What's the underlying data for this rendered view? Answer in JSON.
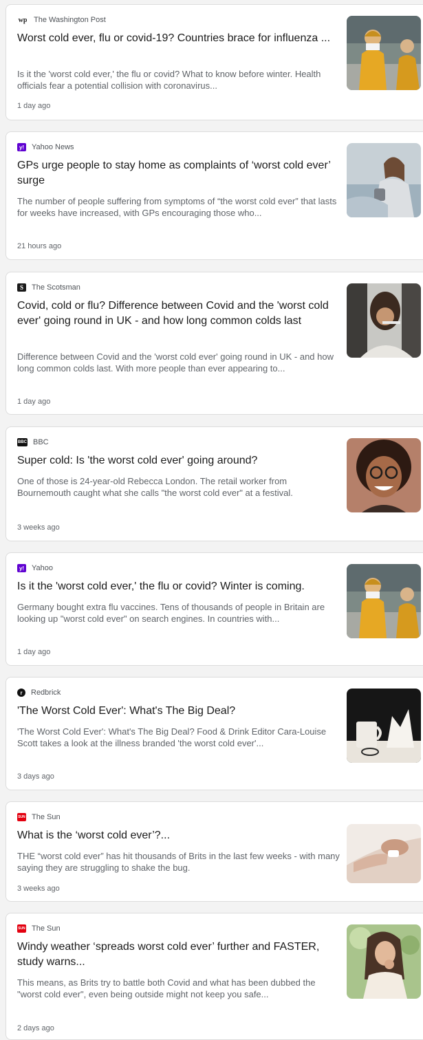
{
  "articles": [
    {
      "source": "The Washington Post",
      "logo_text": "wp",
      "logo_color": "#222222",
      "title": "Worst cold ever, flu or covid-19? Countries brace for influenza ...",
      "snippet": "Is it the 'worst cold ever,' the flu or covid? What to know before winter. Health officials fear a potential collision with coronavirus...",
      "time": "1 day ago",
      "image": "woman-yellow-jacket-blowing-nose"
    },
    {
      "source": "Yahoo News",
      "logo_text": "y!",
      "logo_color": "#5f01d1",
      "title": "GPs urge people to stay home as complaints of ‘worst cold ever’ surge",
      "snippet": "The number of people suffering from symptoms of “the worst cold ever” that lasts for weeks have increased, with GPs encouraging those who...",
      "time": "21 hours ago",
      "image": "woman-on-sofa-with-tissue"
    },
    {
      "source": "The Scotsman",
      "logo_text": "S",
      "logo_color": "#1a1a1a",
      "title": "Covid, cold or flu? Difference between Covid and the 'worst cold ever' going round in UK - and how long common colds last",
      "snippet": "Difference between Covid and the 'worst cold ever' going round in UK - and how long common colds last. With more people than ever appearing to...",
      "time": "1 day ago",
      "image": "woman-in-bed-with-thermometer"
    },
    {
      "source": "BBC",
      "logo_text": "BBC",
      "logo_color": "#111111",
      "title": "Super cold: Is 'the worst cold ever' going around?",
      "snippet": "One of those is 24-year-old Rebecca London. The retail worker from Bournemouth caught what she calls \"the worst cold ever\" at a festival.",
      "time": "3 weeks ago",
      "image": "smiling-woman-with-glasses"
    },
    {
      "source": "Yahoo",
      "logo_text": "y!",
      "logo_color": "#5f01d1",
      "title": "Is it the 'worst cold ever,' the flu or covid? Winter is coming.",
      "snippet": "Germany bought extra flu vaccines. Tens of thousands of people in Britain are looking up \"worst cold ever\" on search engines. In countries with...",
      "time": "1 day ago",
      "image": "woman-yellow-jacket-blowing-nose"
    },
    {
      "source": "Redbrick",
      "logo_text": "r",
      "logo_color": "#111111",
      "title": "'The Worst Cold Ever': What's The Big Deal?",
      "snippet": "'The Worst Cold Ever': What's The Big Deal? Food & Drink Editor Cara-Louise Scott takes a look at the illness branded 'the worst cold ever'...",
      "time": "3 days ago",
      "image": "mug-glasses-and-tissues"
    },
    {
      "source": "The Sun",
      "logo_text": "SUN",
      "logo_color": "#e3000f",
      "title": "What is the ‘worst cold ever’?...",
      "snippet": "THE “worst cold ever” has hit thousands of Brits in the last few weeks - with many saying they are struggling to shake the bug.",
      "time": "3 weeks ago",
      "image": "person-lying-with-tissue"
    },
    {
      "source": "The Sun",
      "logo_text": "SUN",
      "logo_color": "#e3000f",
      "title": "Windy weather ‘spreads worst cold ever’ further and FASTER, study warns...",
      "snippet": "This means, as Brits try to battle both Covid and what has been dubbed the \"worst cold ever\", even being outside might not keep you safe...",
      "time": "2 days ago",
      "image": "woman-coughing-outdoors"
    }
  ]
}
